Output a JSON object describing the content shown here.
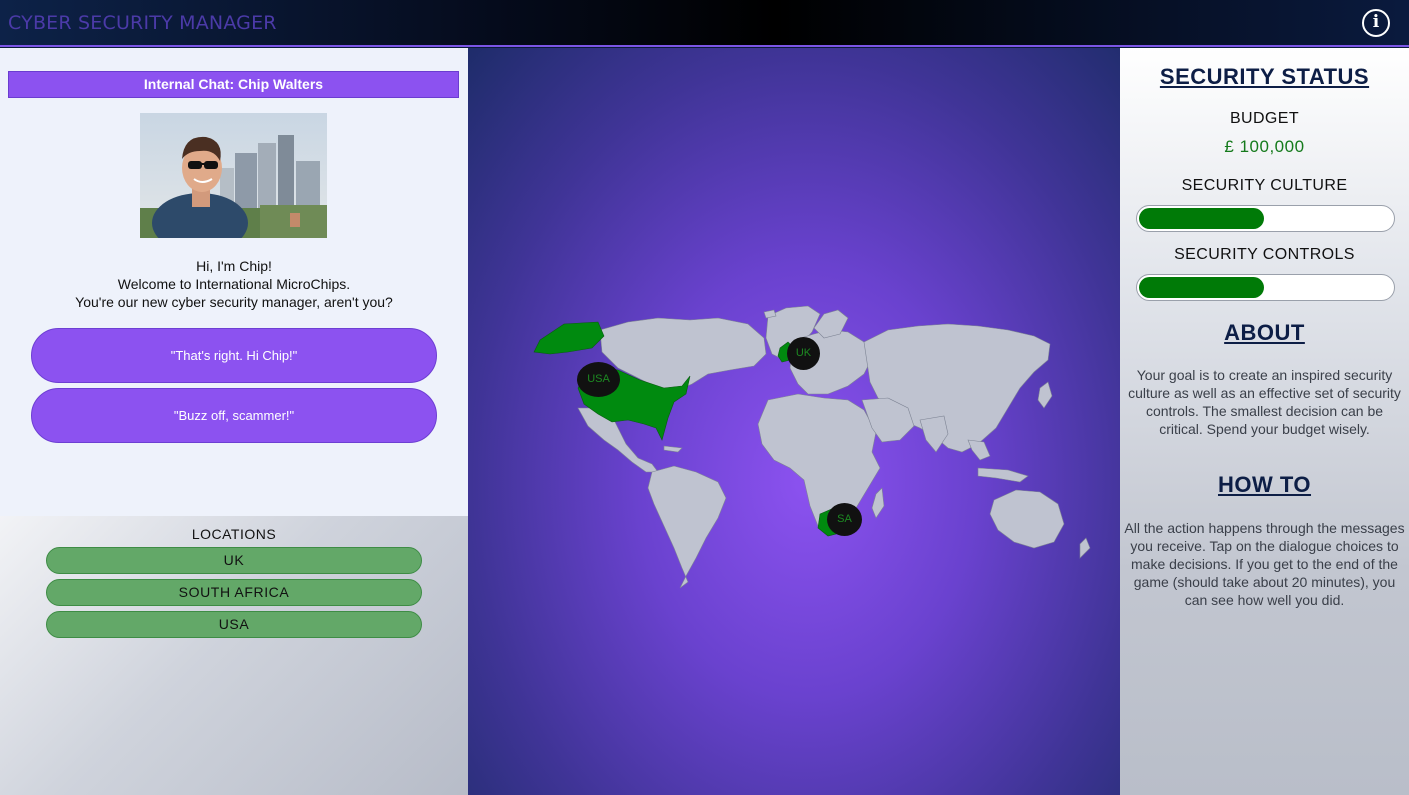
{
  "header": {
    "title": "CYBER SECURITY MANAGER",
    "info_icon": "info-icon"
  },
  "chat": {
    "header": "Internal Chat: Chip Walters",
    "message_lines": [
      "Hi, I'm Chip!",
      "Welcome to International MicroChips.",
      "You're our new cyber security manager, aren't you?"
    ],
    "choices": [
      "\"That's right. Hi Chip!\"",
      "\"Buzz off, scammer!\""
    ]
  },
  "locations": {
    "title": "LOCATIONS",
    "items": [
      "UK",
      "SOUTH AFRICA",
      "USA"
    ]
  },
  "map": {
    "markers": [
      "UK",
      "USA",
      "SA"
    ],
    "highlight_color": "#008a0f",
    "land_color": "#bfc3d0"
  },
  "status": {
    "title": "SECURITY STATUS",
    "budget_label": "BUDGET",
    "budget_value": "£ 100,000",
    "culture_label": "SECURITY CULTURE",
    "culture_level": 0.49,
    "controls_label": "SECURITY CONTROLS",
    "controls_level": 0.49,
    "bar_color": "#007a07",
    "about_title": "ABOUT",
    "about_text": "Your goal is to create an inspired security culture as well as an effective set of security controls. The smallest decision can be critical. Spend your budget wisely.",
    "howto_title": "HOW TO",
    "howto_text": "All the action happens through the messages you receive. Tap on the dialogue choices to make decisions. If you get to the end of the game (should take about 20 minutes), you can see how well you did."
  }
}
